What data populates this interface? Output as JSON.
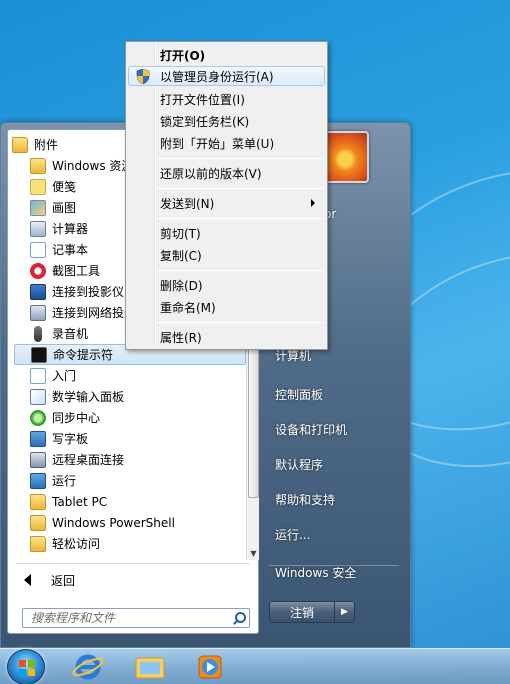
{
  "context_menu": {
    "items": [
      {
        "label": "打开(O)"
      },
      {
        "label": "以管理员身份运行(A)"
      },
      {
        "label": "打开文件位置(I)"
      },
      {
        "label": "锁定到任务栏(K)"
      },
      {
        "label": "附到「开始」菜单(U)"
      },
      {
        "label": "还原以前的版本(V)"
      },
      {
        "label": "发送到(N)"
      },
      {
        "label": "剪切(T)"
      },
      {
        "label": "复制(C)"
      },
      {
        "label": "删除(D)"
      },
      {
        "label": "重命名(M)"
      },
      {
        "label": "属性(R)"
      }
    ]
  },
  "programs": {
    "items": [
      {
        "label": "附件",
        "icon": "folder-icon"
      },
      {
        "label": "Windows 资源管理器",
        "icon": "explorer-icon"
      },
      {
        "label": "便笺",
        "icon": "sticky-notes-icon"
      },
      {
        "label": "画图",
        "icon": "paint-icon"
      },
      {
        "label": "计算器",
        "icon": "calculator-icon"
      },
      {
        "label": "记事本",
        "icon": "notepad-icon"
      },
      {
        "label": "截图工具",
        "icon": "snipping-tool-icon"
      },
      {
        "label": "连接到投影仪",
        "icon": "projector-icon"
      },
      {
        "label": "连接到网络投影仪",
        "icon": "network-projector-icon"
      },
      {
        "label": "录音机",
        "icon": "sound-recorder-icon"
      },
      {
        "label": "命令提示符",
        "icon": "command-prompt-icon"
      },
      {
        "label": "入门",
        "icon": "getting-started-icon"
      },
      {
        "label": "数学输入面板",
        "icon": "math-input-icon"
      },
      {
        "label": "同步中心",
        "icon": "sync-center-icon"
      },
      {
        "label": "写字板",
        "icon": "wordpad-icon"
      },
      {
        "label": "远程桌面连接",
        "icon": "remote-desktop-icon"
      },
      {
        "label": "运行",
        "icon": "run-icon"
      },
      {
        "label": "Tablet PC",
        "icon": "folder-icon"
      },
      {
        "label": "Windows PowerShell",
        "icon": "folder-icon"
      },
      {
        "label": "轻松访问",
        "icon": "folder-icon"
      }
    ],
    "back_label": "返回"
  },
  "search": {
    "placeholder": "搜索程序和文件"
  },
  "right_pane": {
    "username": "rator",
    "links": [
      {
        "label": "计算机"
      },
      {
        "label": "控制面板"
      },
      {
        "label": "设备和打印机"
      },
      {
        "label": "默认程序"
      },
      {
        "label": "帮助和支持"
      },
      {
        "label": "运行..."
      },
      {
        "label": "Windows 安全"
      }
    ],
    "shutdown_label": "注销"
  },
  "taskbar": {
    "pinned": [
      "internet-explorer-icon",
      "windows-explorer-icon",
      "media-player-icon"
    ]
  },
  "colors": {
    "desktop": "#2a9fe0",
    "menu_highlight": "#dcebfc",
    "start_menu_frame": "#4f6b87"
  }
}
